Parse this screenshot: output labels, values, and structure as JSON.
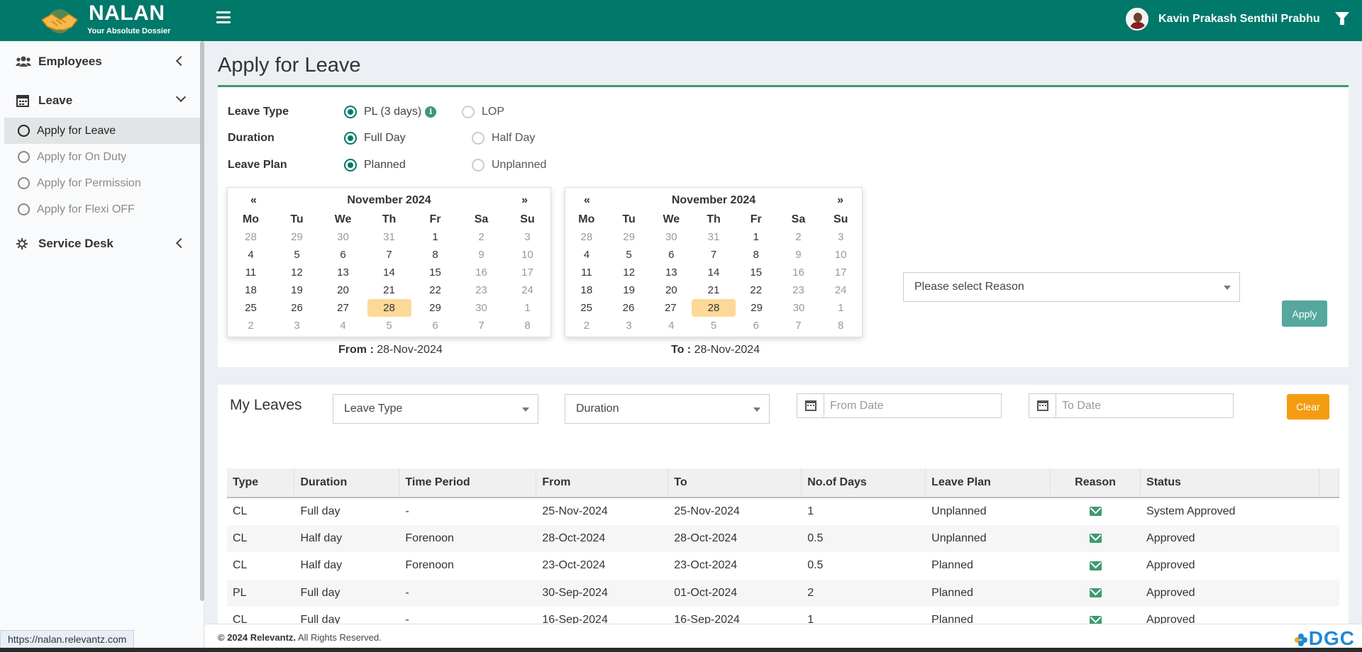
{
  "header": {
    "logo_title": "NALAN",
    "logo_subtitle": "Your Absolute Dossier",
    "user_name": "Kavin Prakash Senthil Prabhu",
    "bg_color": "#00786a"
  },
  "sidebar": {
    "employees": "Employees",
    "leave": "Leave",
    "leave_items": [
      "Apply for Leave",
      "Apply for On Duty",
      "Apply for Permission",
      "Apply for Flexi OFF"
    ],
    "service_desk": "Service Desk"
  },
  "page": {
    "title": "Apply for Leave"
  },
  "form": {
    "leave_type_label": "Leave Type",
    "leave_type_options": [
      "PL (3 days)",
      "LOP"
    ],
    "leave_type_selected": "PL (3 days)",
    "duration_label": "Duration",
    "duration_options": [
      "Full Day",
      "Half Day"
    ],
    "duration_selected": "Full Day",
    "leave_plan_label": "Leave Plan",
    "leave_plan_options": [
      "Planned",
      "Unplanned"
    ],
    "leave_plan_selected": "Planned",
    "reason_placeholder": "Please select Reason",
    "apply_button": "Apply"
  },
  "calendars": {
    "prev": "«",
    "next": "»",
    "month": "November 2024",
    "days_of_week": [
      "Mo",
      "Tu",
      "We",
      "Th",
      "Fr",
      "Sa",
      "Su"
    ],
    "weeks": [
      [
        "28",
        "29",
        "30",
        "31",
        "1",
        "2",
        "3"
      ],
      [
        "4",
        "5",
        "6",
        "7",
        "8",
        "9",
        "10"
      ],
      [
        "11",
        "12",
        "13",
        "14",
        "15",
        "16",
        "17"
      ],
      [
        "18",
        "19",
        "20",
        "21",
        "22",
        "23",
        "24"
      ],
      [
        "25",
        "26",
        "27",
        "28",
        "29",
        "30",
        "1"
      ],
      [
        "2",
        "3",
        "4",
        "5",
        "6",
        "7",
        "8"
      ]
    ],
    "highlighted_date": "28",
    "from_label": "From :",
    "from_value": "28-Nov-2024",
    "to_label": "To :",
    "to_value": "28-Nov-2024"
  },
  "my_leaves": {
    "title": "My Leaves",
    "filter_leave_type": "Leave Type",
    "filter_duration": "Duration",
    "from_date_placeholder": "From Date",
    "to_date_placeholder": "To Date",
    "clear_button": "Clear",
    "columns": [
      "Type",
      "Duration",
      "Time Period",
      "From",
      "To",
      "No.of Days",
      "Leave Plan",
      "Reason",
      "Status"
    ],
    "rows": [
      [
        "CL",
        "Full day",
        "-",
        "25-Nov-2024",
        "25-Nov-2024",
        "1",
        "Unplanned",
        "mail-icon",
        "System Approved"
      ],
      [
        "CL",
        "Half day",
        "Forenoon",
        "28-Oct-2024",
        "28-Oct-2024",
        "0.5",
        "Unplanned",
        "mail-icon",
        "Approved"
      ],
      [
        "CL",
        "Half day",
        "Forenoon",
        "23-Oct-2024",
        "23-Oct-2024",
        "0.5",
        "Planned",
        "mail-icon",
        "Approved"
      ],
      [
        "PL",
        "Full day",
        "-",
        "30-Sep-2024",
        "01-Oct-2024",
        "2",
        "Planned",
        "mail-icon",
        "Approved"
      ],
      [
        "CL",
        "Full day",
        "-",
        "16-Sep-2024",
        "16-Sep-2024",
        "1",
        "Planned",
        "mail-icon",
        "Approved"
      ]
    ]
  },
  "footer": {
    "copyright_bold": "© 2024 Relevantz.",
    "copyright_rest": " All Rights Reserved.",
    "brand": "DGC"
  },
  "status_bar": {
    "url": "https://nalan.relevantz.com"
  }
}
